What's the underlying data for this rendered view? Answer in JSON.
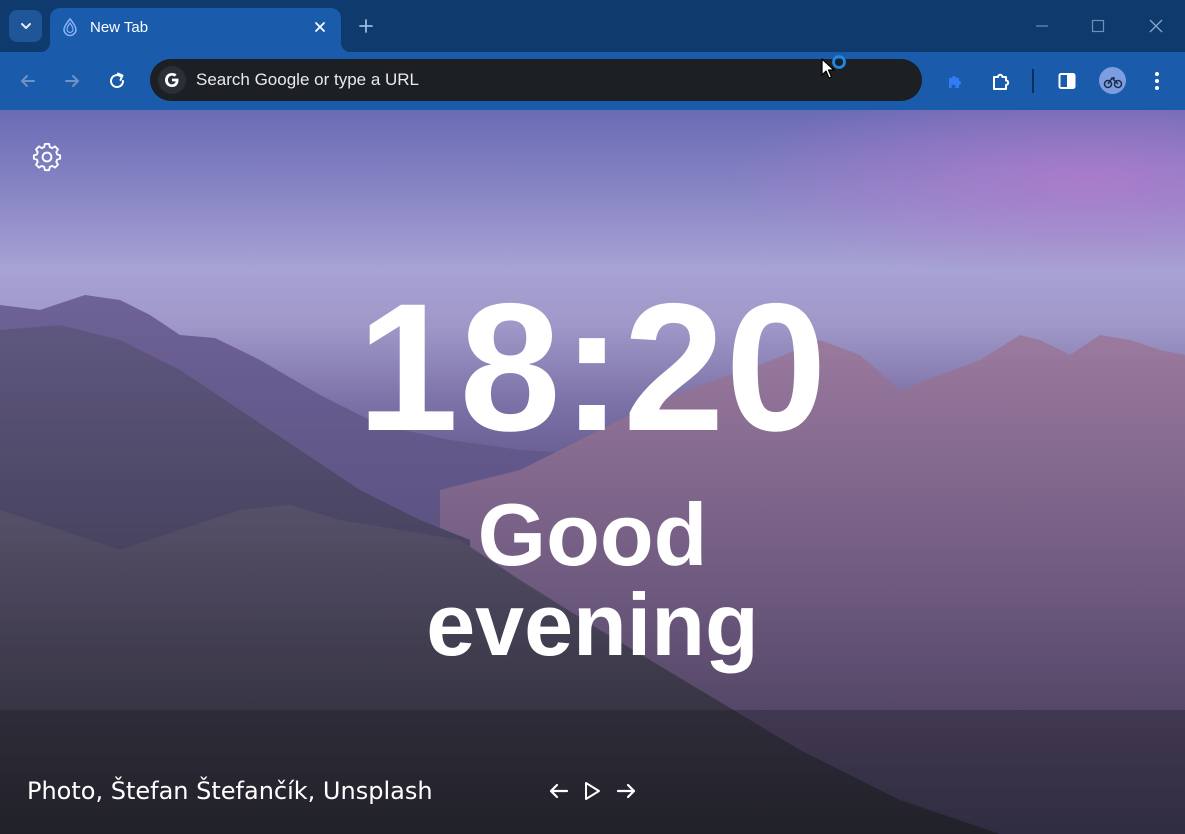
{
  "browser": {
    "tab": {
      "title": "New Tab",
      "favicon": "droplet-logo-icon"
    },
    "toolbar": {
      "omnibox_placeholder": "Search Google or type a URL"
    },
    "icons": {
      "tab_search": "chevron-down-icon",
      "close_tab": "close-icon",
      "new_tab": "plus-icon",
      "back": "arrow-left-icon",
      "forward": "arrow-right-icon",
      "reload": "reload-icon",
      "search_engine": "google-g-icon",
      "extension_active": "puzzle-piece-icon",
      "extensions": "extensions-icon",
      "side_panel": "side-panel-icon",
      "profile": "avatar-icon",
      "menu": "kebab-menu-icon",
      "minimize": "minimize-icon",
      "maximize": "maximize-icon",
      "close_window": "close-window-icon"
    },
    "colors": {
      "frame": "#0f3a6e",
      "active_tab": "#1a5bab",
      "omnibox": "#1c1f24",
      "extension_accent": "#2f7cf5"
    }
  },
  "newtab": {
    "time": "18:20",
    "greeting_line1": "Good",
    "greeting_line2": "evening",
    "photo_credit": "Photo, Štefan Štefančík, Unsplash",
    "controls": [
      "previous",
      "play",
      "next"
    ]
  }
}
